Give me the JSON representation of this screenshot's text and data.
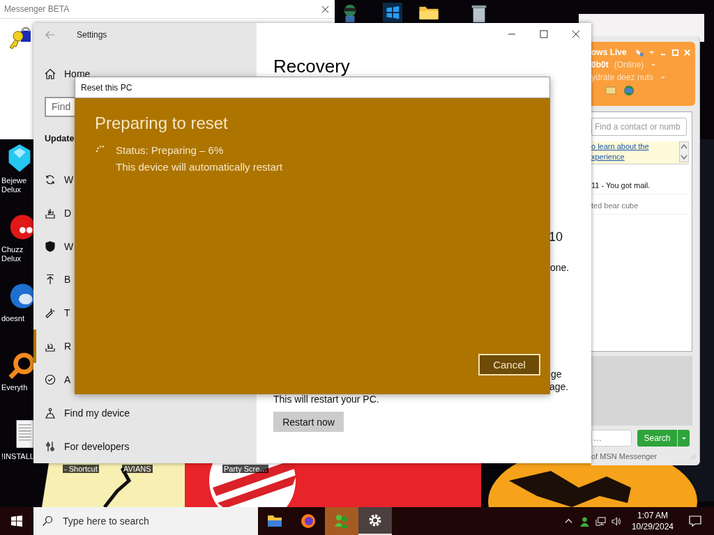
{
  "messenger_beta": {
    "title": "Messenger BETA"
  },
  "desktop_icons": [
    {
      "kind": "gem",
      "label": "Bejewe Delux"
    },
    {
      "kind": "red-ball",
      "label": "Chuzz Delux"
    },
    {
      "kind": "bird",
      "label": "doesnt"
    },
    {
      "kind": "magnifier",
      "label": "Everyth"
    },
    {
      "kind": "document",
      "label": "!INSTALL"
    }
  ],
  "desktop_bottom_labels": [
    "- Shortcut",
    "AVIANS",
    "Party Scre…"
  ],
  "settings": {
    "title": "Settings",
    "home": "Home",
    "search_placeholder": "Find",
    "section": "Update",
    "items": [
      {
        "kind": "sync",
        "label": "W",
        "selected": false
      },
      {
        "kind": "delivery",
        "label": "D",
        "selected": false
      },
      {
        "kind": "shield",
        "label": "W",
        "selected": false
      },
      {
        "kind": "backup",
        "label": "B",
        "selected": false
      },
      {
        "kind": "wrench",
        "label": "T",
        "selected": false
      },
      {
        "kind": "recovery",
        "label": "R",
        "selected": true
      },
      {
        "kind": "check",
        "label": "A",
        "selected": false
      },
      {
        "kind": "find",
        "label": "Find my device",
        "selected": false
      },
      {
        "kind": "developer",
        "label": "For developers",
        "selected": false
      }
    ],
    "page_title": "Recovery",
    "fragments": [
      "10",
      "one.",
      "ge",
      "age."
    ],
    "restart_note": "This will restart your PC.",
    "restart_button": "Restart now"
  },
  "reset_dialog": {
    "title": "Reset this PC",
    "heading": "Preparing to reset",
    "status": "Status: Preparing – 6%",
    "note": "This device will automatically restart",
    "cancel": "Cancel"
  },
  "messenger": {
    "brand": "ows Live",
    "user": "0b0t",
    "status": "(Online)",
    "personal_message": "ydrate deez nuts",
    "search_placeholder": "Find a contact or numb",
    "info_link": [
      "o learn about the",
      "xperience"
    ],
    "contacts": [
      {
        "text": "11 - You got mail.",
        "muted": false
      },
      {
        "text": "ted bear cube",
        "muted": true
      }
    ],
    "web_search_placeholder": "…",
    "search_button": "Search",
    "footer": "of MSN Messenger"
  },
  "taskbar": {
    "search_placeholder": "Type here to search",
    "apps": [
      {
        "kind": "folder",
        "selected": false,
        "flashing": false
      },
      {
        "kind": "firefox",
        "selected": false,
        "flashing": false
      },
      {
        "kind": "messenger",
        "selected": false,
        "flashing": true
      },
      {
        "kind": "settings",
        "selected": true,
        "flashing": false
      }
    ],
    "time": "1:07 AM",
    "date": "10/29/2024"
  }
}
